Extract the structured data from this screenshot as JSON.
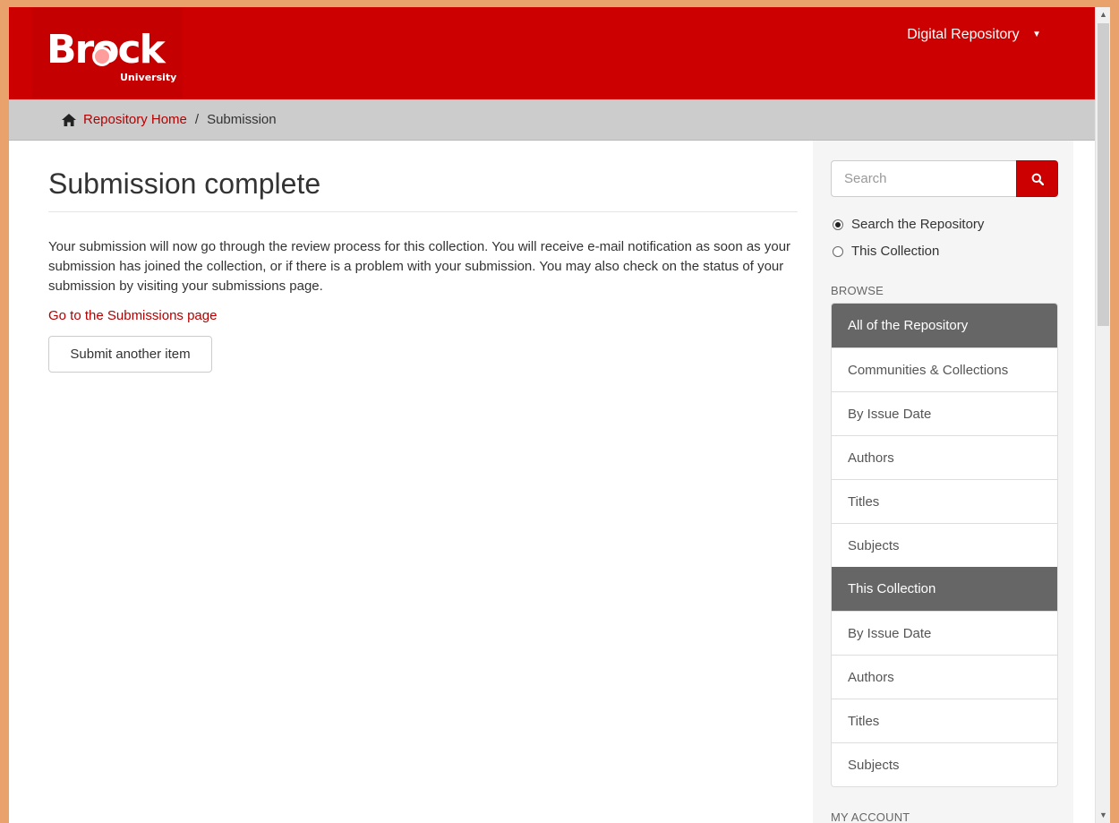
{
  "header": {
    "logo_word": "Brock",
    "logo_sub": "University",
    "menu_label": "Digital Repository"
  },
  "breadcrumb": {
    "home_label": "Repository Home",
    "separator": "/",
    "current": "Submission"
  },
  "main": {
    "title": "Submission complete",
    "message": "Your submission will now go through the review process for this collection. You will receive e-mail notification as soon as your submission has joined the collection, or if there is a problem with your submission. You may also check on the status of your submission by visiting your submissions page.",
    "submissions_link": "Go to the Submissions page",
    "submit_another": "Submit another item"
  },
  "sidebar": {
    "search_placeholder": "Search",
    "scope_repository": "Search the Repository",
    "scope_collection": "This Collection",
    "browse_label": "BROWSE",
    "repository_header": "All of the Repository",
    "repository_items": [
      "Communities & Collections",
      "By Issue Date",
      "Authors",
      "Titles",
      "Subjects"
    ],
    "collection_header": "This Collection",
    "collection_items": [
      "By Issue Date",
      "Authors",
      "Titles",
      "Subjects"
    ],
    "account_label": "MY ACCOUNT"
  },
  "colors": {
    "brand_red": "#cc0000",
    "link_red": "#b40000",
    "browse_header_gray": "#666666"
  }
}
